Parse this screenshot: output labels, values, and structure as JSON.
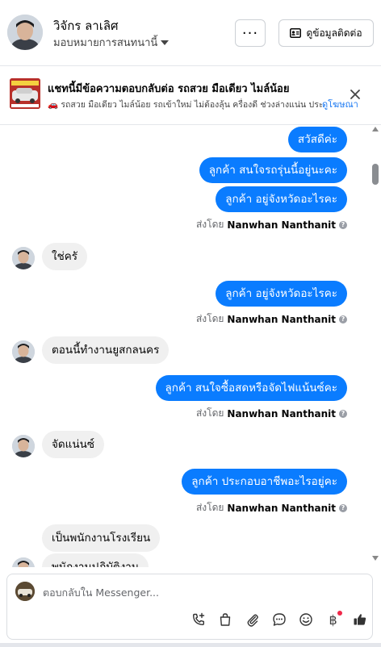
{
  "header": {
    "name": "วิจักร ลาเลิศ",
    "assign_label": "มอบหมายการสนทนานี้",
    "more_label": "···",
    "contact_label": "ดูข้อมูลติดต่อ"
  },
  "ad": {
    "title": "แชทนี้มีข้อความตอบกลับต่อ รถสวย มือเดียว ไมล์น้อย",
    "description": "🚗 รถสวย มือเดียว ไมล์น้อย รถเข้าใหม่ ไม่ต้องลุ้น ครื่องดี ช่วงล่างแน่น ประ...",
    "link_label": "ดูโฆษณา"
  },
  "messages": [
    {
      "dir": "out",
      "text": "สวัสดีค่ะ"
    },
    {
      "dir": "out",
      "text": "ลูกค้า สนใจรถรุ่นนี้อยู่นะคะ"
    },
    {
      "dir": "out",
      "text": "ลูกค้า อยู่จังหวัดอะไรคะ"
    },
    {
      "dir": "in",
      "text": "ใช่ครั"
    },
    {
      "dir": "out",
      "text": "ลูกค้า อยู่จังหวัดอะไรคะ"
    },
    {
      "dir": "in",
      "text": "ตอนนี้ทำงานยูสกลนคร"
    },
    {
      "dir": "out",
      "text": "ลูกค้า สนใจซื้อสดหรือจัดไฟแน้นซ์คะ"
    },
    {
      "dir": "in",
      "text": "จัดแน่นซ์"
    },
    {
      "dir": "out",
      "text": "ลูกค้า ประกอบอาชีพอะไรอยู่คะ"
    },
    {
      "dir": "in",
      "text": "เป็นพนักงานโรงเรียน"
    },
    {
      "dir": "in",
      "text": "พนักงานปฏิบัติงาน"
    }
  ],
  "sent_by": {
    "prefix": "ส่งโดย",
    "agent": "Nanwhan Nanthanit",
    "info_glyph": "?"
  },
  "composer": {
    "placeholder": "ตอบกลับใน Messenger...",
    "value": "",
    "currency_glyph": "฿"
  },
  "colors": {
    "outgoing_bubble": "#0a7cff",
    "incoming_bubble": "#f0f0f0",
    "link": "#1877f2",
    "notification_dot": "#f02849"
  }
}
